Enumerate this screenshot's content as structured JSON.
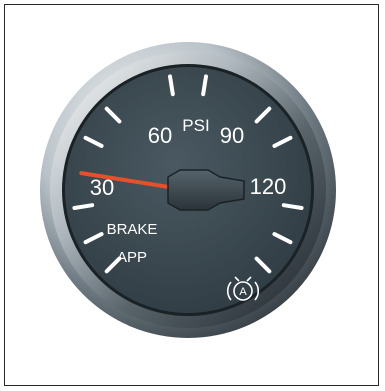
{
  "gauge": {
    "unit_label": "PSI",
    "line1_label": "BRAKE",
    "line2_label": "APP",
    "tick_labels": [
      "30",
      "60",
      "90",
      "120"
    ],
    "reading": 30,
    "scale_min": 0,
    "scale_max": 150,
    "needle_color": "#e8502a",
    "dial_color": "#3b4850",
    "indicator_icon": "parking-brake-icon"
  }
}
